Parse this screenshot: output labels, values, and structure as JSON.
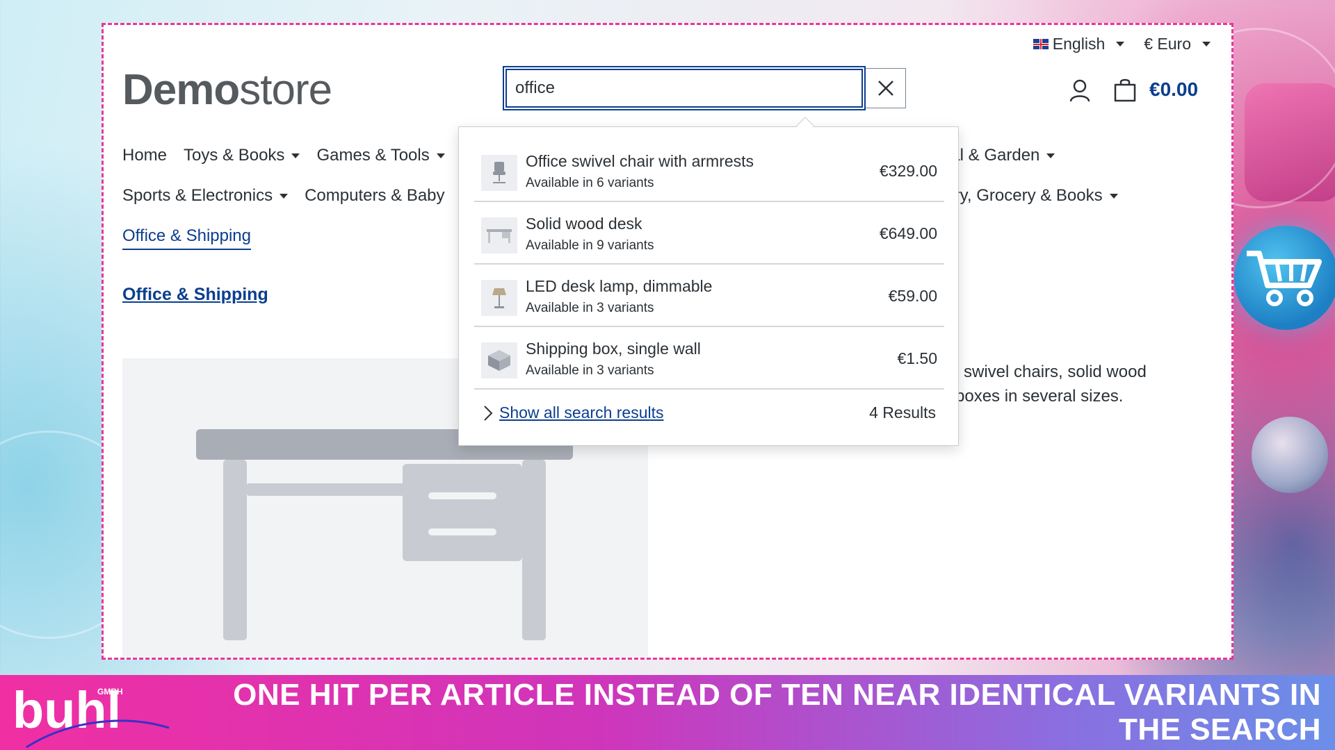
{
  "topbar": {
    "language": "English",
    "currency": "€ Euro"
  },
  "logo": {
    "bold": "Demo",
    "light": "store"
  },
  "search": {
    "value": "office",
    "placeholder": ""
  },
  "cart": {
    "total": "€0.00"
  },
  "nav": {
    "row1": [
      "Home",
      "Toys & Books",
      "Games & Tools"
    ],
    "row1_right": "rial & Garden",
    "row2": [
      "Sports & Electronics",
      "Computers & Baby"
    ],
    "row2_right": "elry, Grocery & Books",
    "active": "Office & Shipping"
  },
  "category": {
    "link": "Office & Shipping"
  },
  "description": {
    "line1": "ce swivel chairs, solid wood",
    "line2": "g boxes in several sizes."
  },
  "dropdown": {
    "results": [
      {
        "name": "Office swivel chair with armrests",
        "variants": "Available in 6 variants",
        "price": "€329.00",
        "icon": "chair-icon"
      },
      {
        "name": "Solid wood desk",
        "variants": "Available in 9 variants",
        "price": "€649.00",
        "icon": "desk-icon"
      },
      {
        "name": "LED desk lamp, dimmable",
        "variants": "Available in 3 variants",
        "price": "€59.00",
        "icon": "lamp-icon"
      },
      {
        "name": "Shipping box, single wall",
        "variants": "Available in 3 variants",
        "price": "€1.50",
        "icon": "box-icon"
      }
    ],
    "show_all": "Show all search results",
    "count": "4 Results"
  },
  "banner": {
    "brand": "buhl",
    "brand_sub": "GMBH",
    "headline": "ONE HIT PER ARTICLE INSTEAD OF TEN NEAR IDENTICAL VARIANTS IN THE SEARCH"
  },
  "colors": {
    "accent": "#0b3e8f",
    "frame": "#e8369a",
    "banner_start": "#f02fa3",
    "banner_end": "#6b8fe8"
  }
}
